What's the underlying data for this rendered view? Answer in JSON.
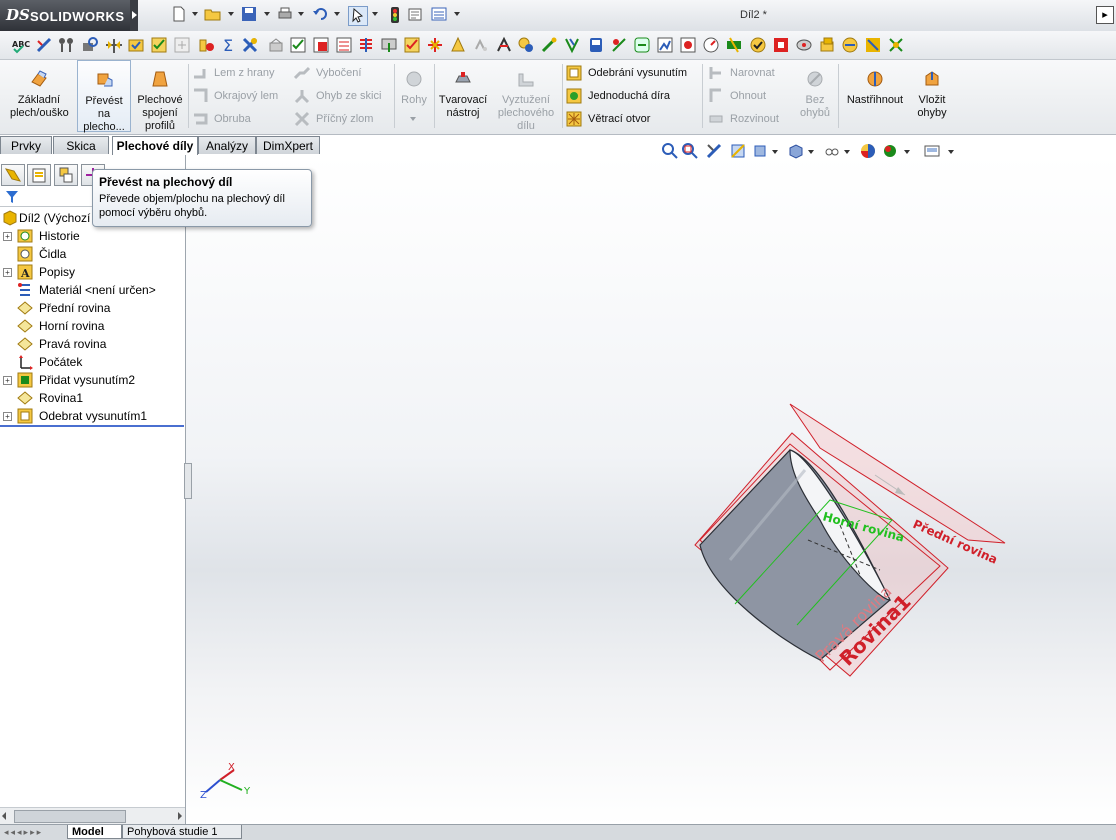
{
  "app": {
    "brand_prefix": "DS",
    "brand_name": "SOLIDWORKS",
    "document_title": "Díl2 *"
  },
  "ribbon": {
    "zakladni_plech": "Základní plech/ouško",
    "prevest": "Převést na plecho...",
    "plechove_spojeni": "Plechové spojení profilů",
    "lem_z_hrany": "Lem z hrany",
    "okrajovy_lem": "Okrajový lem",
    "obruba": "Obruba",
    "vyboceni": "Vybočení",
    "ohyb_ze_skici": "Ohyb ze skici",
    "pricny_zlom": "Příčný zlom",
    "rohy": "Rohy",
    "tvarovaci_nastroj": "Tvarovací nástroj",
    "vyztuzeni": "Vyztužení plechového dílu",
    "odebrani_vysunutim": "Odebrání vysunutím",
    "jednoducha_dira": "Jednoduchá díra",
    "vetraci_otvor": "Větrací otvor",
    "narovnat": "Narovnat",
    "ohnout": "Ohnout",
    "rozvinout": "Rozvinout",
    "bez_ohybu": "Bez ohybů",
    "nastrihnout": "Nastřihnout",
    "vlozit_ohyby": "Vložit ohyby"
  },
  "tabs": [
    "Prvky",
    "Skica",
    "Plechové díly",
    "Analýzy",
    "DimXpert"
  ],
  "tooltip": {
    "title": "Převést na plechový díl",
    "description": "Převede objem/plochu na plechový díl pomocí výběru ohybů."
  },
  "tree": {
    "root": "Díl2  (Výchozí",
    "items": [
      "Historie",
      "Čidla",
      "Popisy",
      "Materiál <není určen>",
      "Přední rovina",
      "Horní rovina",
      "Pravá rovina",
      "Počátek",
      "Přidat vysunutím2",
      "Rovina1",
      "Odebrat vysunutím1"
    ]
  },
  "viewport": {
    "plane_labels": {
      "horni": "Horní rovina",
      "predni": "Přední rovina",
      "prava": "Pravá rovina",
      "rovina1": "Rovina1"
    },
    "triad": {
      "x": "X",
      "y": "Y",
      "z": "Z"
    }
  },
  "bottom_tabs": [
    "Model",
    "Pohybová studie 1"
  ],
  "colors": {
    "plane_red": "#d0202a",
    "plane_green": "#22c020",
    "body_gray": "#8e95a3"
  }
}
